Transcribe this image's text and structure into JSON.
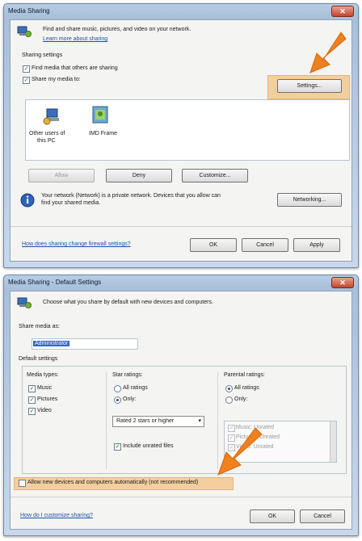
{
  "dialog1": {
    "title": "Media Sharing",
    "intro": "Find and share music, pictures, and video on your network.",
    "learn_more": "Learn more about sharing",
    "section_label": "Sharing settings",
    "find_media_label": "Find media that others are sharing",
    "share_media_label": "Share my media to:",
    "settings_button": "Settings...",
    "devices": [
      {
        "label_line1": "Other users of",
        "label_line2": "this PC",
        "icon": "users-pc-icon"
      },
      {
        "label_line1": "IMD Frame",
        "label_line2": "",
        "icon": "photo-frame-icon"
      }
    ],
    "allow_button": "Allow",
    "deny_button": "Deny",
    "customize_button": "Customize...",
    "network_text_line1": "Your network (Network) is a private network. Devices that you allow can",
    "network_text_line2": "find your shared media.",
    "networking_button": "Networking...",
    "firewall_link": "How does sharing change firewall settings?",
    "ok_button": "OK",
    "cancel_button": "Cancel",
    "apply_button": "Apply"
  },
  "dialog2": {
    "title": "Media Sharing - Default Settings",
    "intro": "Choose what you share by default with new devices and computers.",
    "share_media_as_label": "Share media as:",
    "share_media_as_value": "Administrator",
    "default_settings_label": "Default settings",
    "media_types_label": "Media types:",
    "media_types": [
      "Music",
      "Pictures",
      "Video"
    ],
    "star_ratings_label": "Star ratings:",
    "all_ratings_label": "All ratings",
    "only_label": "Only:",
    "stars_select_value": "Rated 2 stars or higher",
    "include_unrated_label": "Include unrated files",
    "parental_ratings_label": "Parental ratings:",
    "parental_all_label": "All ratings",
    "parental_only_label": "Only:",
    "parental_list": [
      "Music: Unrated",
      "Pictures: Unrated",
      "Video: Unrated"
    ],
    "allow_new_devices_label": "Allow new devices and computers automatically (not recommended)",
    "customize_link": "How do I customize sharing?",
    "ok_button": "OK",
    "cancel_button": "Cancel"
  },
  "colors": {
    "highlight": "#f3cf9f",
    "arrow": "#f07f1e",
    "link": "#1e4fa8"
  }
}
